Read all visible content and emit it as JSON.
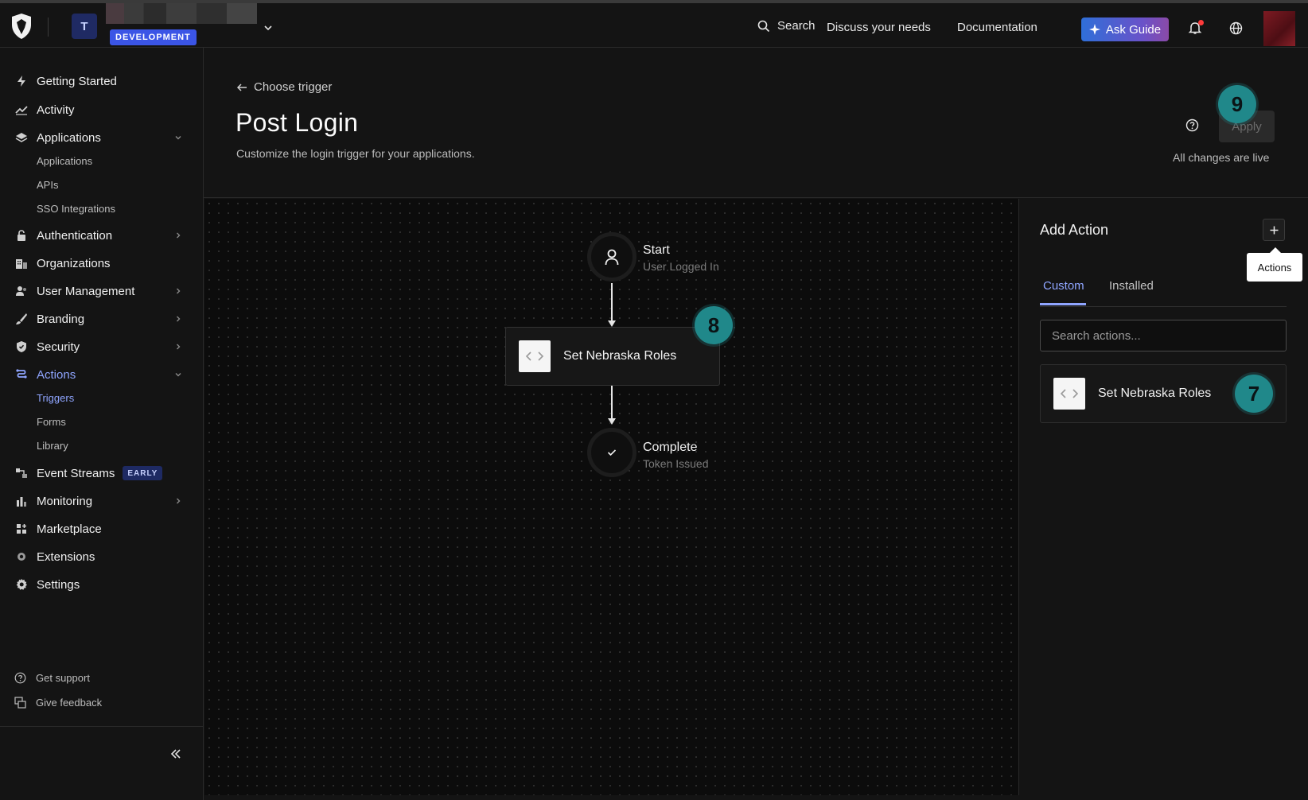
{
  "topbar": {
    "tenant_initial": "T",
    "environment_badge": "DEVELOPMENT",
    "search_label": "Search",
    "discuss_label": "Discuss your needs",
    "documentation_label": "Documentation",
    "ask_guide_label": "Ask Guide",
    "notification_dot": true
  },
  "sidebar": {
    "items": [
      {
        "label": "Getting Started",
        "icon": "bolt-icon"
      },
      {
        "label": "Activity",
        "icon": "trend-icon"
      },
      {
        "label": "Applications",
        "icon": "layers-icon",
        "expanded": true,
        "children": [
          "Applications",
          "APIs",
          "SSO Integrations"
        ]
      },
      {
        "label": "Authentication",
        "icon": "lock-icon"
      },
      {
        "label": "Organizations",
        "icon": "building-icon"
      },
      {
        "label": "User Management",
        "icon": "users-icon"
      },
      {
        "label": "Branding",
        "icon": "brush-icon"
      },
      {
        "label": "Security",
        "icon": "shield-icon"
      },
      {
        "label": "Actions",
        "icon": "flow-icon",
        "active": true,
        "expanded": true,
        "children": [
          "Triggers",
          "Forms",
          "Library"
        ],
        "active_child": "Triggers"
      },
      {
        "label": "Event Streams",
        "icon": "streams-icon",
        "badge": "EARLY"
      },
      {
        "label": "Monitoring",
        "icon": "bar-chart-icon"
      },
      {
        "label": "Marketplace",
        "icon": "grid-plus-icon"
      },
      {
        "label": "Extensions",
        "icon": "gear-small-icon"
      },
      {
        "label": "Settings",
        "icon": "gear-icon"
      }
    ],
    "footer": {
      "support_label": "Get support",
      "feedback_label": "Give feedback"
    }
  },
  "header": {
    "back_label": "Choose trigger",
    "title": "Post Login",
    "subtitle": "Customize the login trigger for your applications.",
    "apply_label": "Apply",
    "status_text": "All changes are live"
  },
  "markers": {
    "apply": "9",
    "flow_action": "8",
    "panel_action": "7"
  },
  "flow": {
    "start": {
      "title": "Start",
      "subtitle": "User Logged In"
    },
    "action": {
      "label": "Set Nebraska Roles"
    },
    "complete": {
      "title": "Complete",
      "subtitle": "Token Issued"
    }
  },
  "panel": {
    "title": "Add Action",
    "add_tooltip": "Actions",
    "tabs": [
      "Custom",
      "Installed"
    ],
    "active_tab": "Custom",
    "search_placeholder": "Search actions...",
    "search_value": "",
    "actions": [
      {
        "label": "Set Nebraska Roles"
      }
    ]
  },
  "colors": {
    "accent": "#8fa5ff",
    "env_badge": "#3b55e6",
    "marker": "#20888a"
  }
}
